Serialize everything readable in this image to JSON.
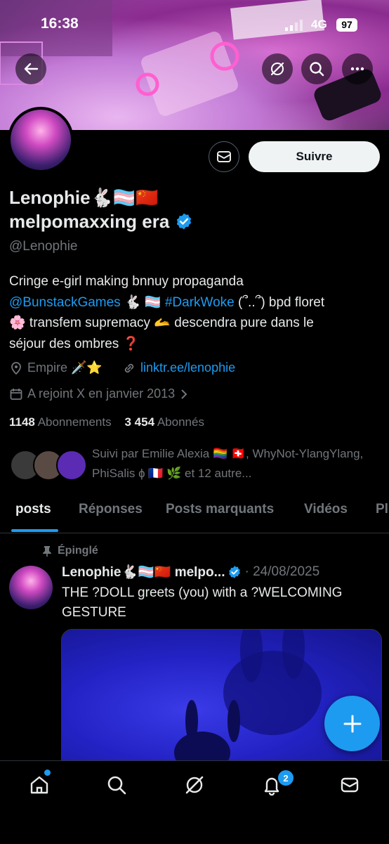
{
  "status_bar": {
    "time": "16:38",
    "network": "4G",
    "battery": "97"
  },
  "profile": {
    "follow_label": "Suivre",
    "name_line1": "Lenophie🐇🏳️‍⚧️🇨🇳",
    "name_line2": "melpomaxxing era",
    "handle": "@Lenophie",
    "bio_line1": "Cringe e-girl making bnnuy propaganda",
    "bio_mention": "@BunstackGames",
    "bio_emoji1": " 🐇 🏳️‍⚧️ ",
    "bio_hashtag": "#DarkWoke",
    "bio_line2_rest": " (՞..՞) bpd floret",
    "bio_line3": "🌸 transfem supremacy 🫴 descendra pure dans le",
    "bio_line4": "séjour des ombres ❓",
    "location": "Empire 🗡️⭐",
    "website": "linktr.ee/lenophie",
    "joined": "A rejoint X en janvier 2013",
    "following_count": "1148",
    "following_label": "Abonnements",
    "followers_count": "3 454",
    "followers_label": "Abonnés",
    "followed_by": "Suivi par Emilie Alexia 🏳️‍🌈 🇨🇭, WhyNot-YlangYlang, PhiSalis ɸ 🇫🇷 🌿  et 12 autre..."
  },
  "tabs": [
    "posts",
    "Réponses",
    "Posts marquants",
    "Vidéos",
    "Pl"
  ],
  "pinned_post": {
    "pinned_label": "Épinglé",
    "author": "Lenophie🐇🏳️‍⚧️🇨🇳 melpo...",
    "date": "· 24/08/2025",
    "text": "THE ?DOLL greets (you) with a ?WELCOMING GESTURE"
  },
  "nav": {
    "notifications_badge": "2"
  },
  "colors": {
    "accent": "#1d9bf0",
    "background": "#000000",
    "muted": "#71767b",
    "text": "#e7e9ea"
  }
}
